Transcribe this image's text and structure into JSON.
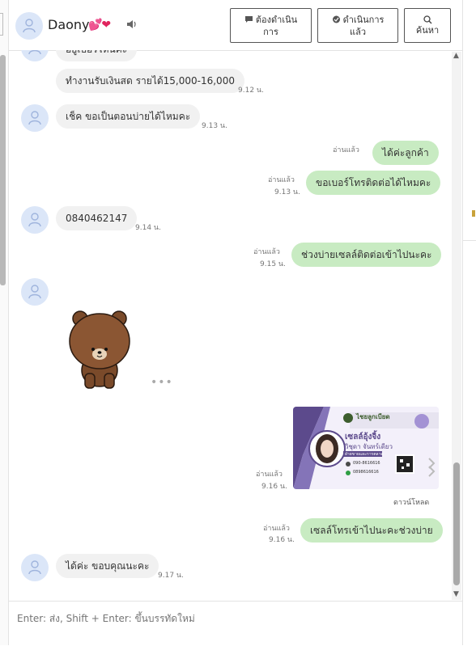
{
  "header": {
    "contact_name": "Daony",
    "contact_emoji": "💕❤",
    "buttons": [
      {
        "label_line1": "ต้องดำเนิน",
        "label_line2": "การ",
        "icon": "speech-bubble-icon"
      },
      {
        "label_line1": "ดำเนินการ",
        "label_line2": "แล้ว",
        "icon": "message-check-icon"
      },
      {
        "label_line1": "",
        "label_line2": "ค้นหา",
        "icon": "search-icon"
      }
    ]
  },
  "messages": [
    {
      "dir": "in",
      "text": "อยู่เบอร์ไหนคะ",
      "time": ""
    },
    {
      "dir": "in",
      "text": "ทำงานรับเงินสด รายได้15,000-16,000",
      "time": "9.12 น."
    },
    {
      "dir": "in",
      "text": "เช็ค ขอเป็นตอนบ่ายได้ไหมคะ",
      "time": "9.13 น."
    },
    {
      "dir": "out",
      "text": "ได้ค่ะลูกค้า",
      "read": "อ่านแล้ว",
      "time": ""
    },
    {
      "dir": "out",
      "text": "ขอเบอร์โทรติดต่อได้ไหมคะ",
      "read": "อ่านแล้ว",
      "time": "9.13 น."
    },
    {
      "dir": "in",
      "text": "0840462147",
      "time": "9.14 น."
    },
    {
      "dir": "out",
      "text": "ช่วงบ่ายเซลล์ติดต่อเข้าไปนะคะ",
      "read": "อ่านแล้ว",
      "time": "9.15 น."
    },
    {
      "dir": "in",
      "type": "sticker",
      "sticker": "brown-bear-sticker"
    },
    {
      "dir": "out",
      "type": "image",
      "read": "อ่านแล้ว",
      "time": "9.16 น.",
      "download_label": "ดาวน์โหลด",
      "card": {
        "brand": "ไชยลูกเบียด",
        "title": "เซลล์อุ้งจิ้ง",
        "name": "วิชุดา จันทร์เดียว",
        "tag": "ฝ่ายขายและการตลาด",
        "phone1": "090-8616616",
        "phone2": "0898616616"
      }
    },
    {
      "dir": "out",
      "text": "เซลล์โทรเข้าไปนะคะช่วงบ่าย",
      "read": "อ่านแล้ว",
      "time": "9.16 น."
    },
    {
      "dir": "in",
      "text": "ได้ค่ะ ขอบคุณนะคะ",
      "time": "9.17 น."
    }
  ],
  "composer": {
    "placeholder": "Enter: ส่ง, Shift + Enter: ขึ้นบรรทัดใหม่"
  },
  "colors": {
    "outgoing_bubble": "#c8ebc2",
    "incoming_bubble": "#f1f1f1",
    "avatar_bg": "#dbe6f8"
  }
}
